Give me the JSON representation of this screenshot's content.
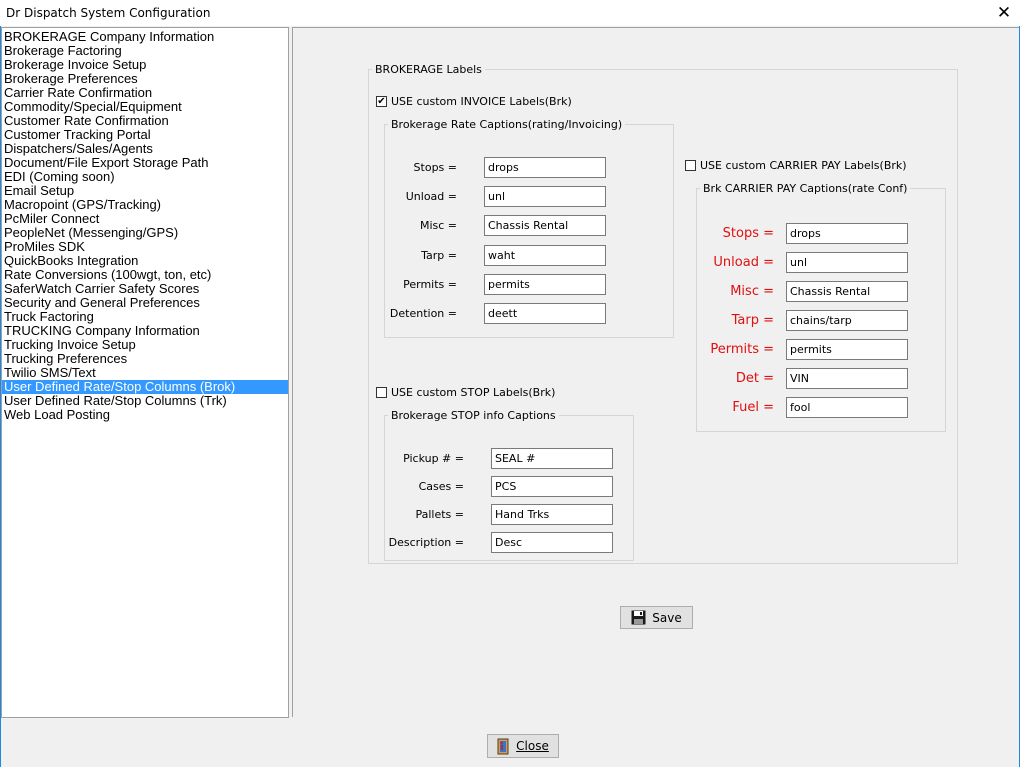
{
  "window": {
    "title": "Dr Dispatch  System Configuration",
    "close_glyph": "✕"
  },
  "config_list": {
    "items": [
      "BROKERAGE Company Information",
      "Brokerage Factoring",
      "Brokerage Invoice Setup",
      "Brokerage Preferences",
      "Carrier Rate Confirmation",
      "Commodity/Special/Equipment",
      "Customer Rate Confirmation",
      "Customer Tracking Portal",
      "Dispatchers/Sales/Agents",
      "Document/File Export Storage Path",
      "EDI (Coming soon)",
      "Email Setup",
      "Macropoint (GPS/Tracking)",
      "PcMiler Connect",
      "PeopleNet (Messenging/GPS)",
      "ProMiles SDK",
      "QuickBooks Integration",
      "Rate Conversions (100wgt, ton, etc)",
      "SaferWatch Carrier Safety Scores",
      "Security and General Preferences",
      "Truck Factoring",
      "TRUCKING Company Information",
      "Trucking Invoice Setup",
      "Trucking Preferences",
      "Twilio SMS/Text",
      "User Defined Rate/Stop Columns (Brok)",
      "User Defined Rate/Stop Columns (Trk)",
      "Web Load Posting"
    ],
    "selected_index": 25
  },
  "brokerage_labels": {
    "title": "BROKERAGE Labels",
    "invoice": {
      "checkbox_label": "USE custom INVOICE Labels(Brk)",
      "checked": true,
      "group_title": "Brokerage Rate Captions(rating/Invoicing)",
      "fields": [
        {
          "label": "Stops =",
          "value": "drops"
        },
        {
          "label": "Unload =",
          "value": "unl"
        },
        {
          "label": "Misc =",
          "value": "Chassis Rental"
        },
        {
          "label": "Tarp =",
          "value": "waht"
        },
        {
          "label": "Permits =",
          "value": "permits"
        },
        {
          "label": "Detention =",
          "value": "deett"
        }
      ]
    },
    "carrier_pay": {
      "checkbox_label": "USE custom CARRIER PAY Labels(Brk)",
      "checked": false,
      "group_title": "Brk CARRIER PAY Captions(rate Conf)",
      "label_color": "#e01010",
      "fields": [
        {
          "label": "Stops =",
          "value": "drops"
        },
        {
          "label": "Unload =",
          "value": "unl"
        },
        {
          "label": "Misc =",
          "value": "Chassis Rental"
        },
        {
          "label": "Tarp =",
          "value": "chains/tarp"
        },
        {
          "label": "Permits =",
          "value": "permits"
        },
        {
          "label": "Det =",
          "value": "VIN"
        },
        {
          "label": "Fuel =",
          "value": "fool"
        }
      ]
    },
    "stop": {
      "checkbox_label": "USE custom STOP Labels(Brk)",
      "checked": false,
      "group_title": "Brokerage STOP info Captions",
      "fields": [
        {
          "label": "Pickup # =",
          "value": "SEAL #"
        },
        {
          "label": "Cases =",
          "value": "PCS"
        },
        {
          "label": "Pallets =",
          "value": "Hand Trks"
        },
        {
          "label": "Description =",
          "value": "Desc"
        }
      ]
    }
  },
  "buttons": {
    "save_label": "Save",
    "save_icon": "floppy-disk-icon",
    "close_label": "Close",
    "close_icon": "door-exit-icon"
  }
}
